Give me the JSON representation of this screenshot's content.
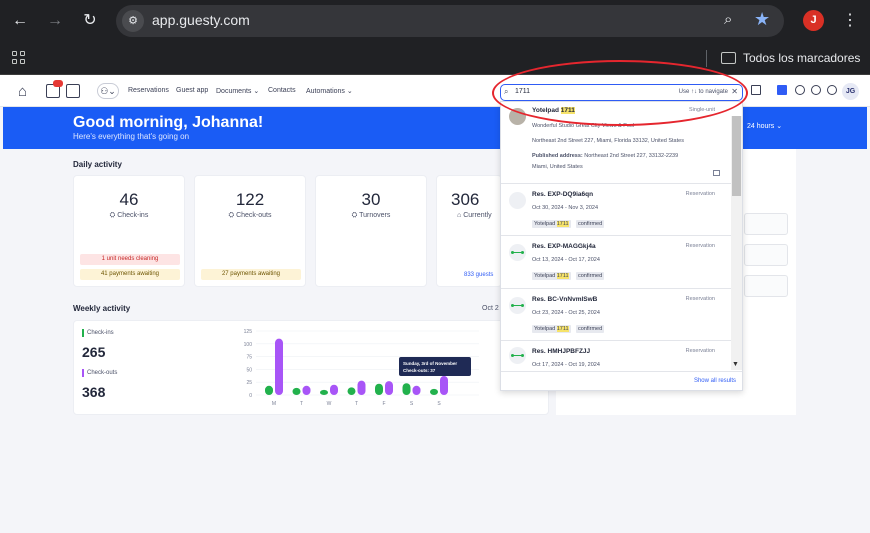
{
  "browser": {
    "url": "app.guesty.com",
    "profile_initial": "J",
    "bookmarks_label": "Todos los marcadores"
  },
  "nav": {
    "notification_count": "",
    "links": [
      "Reservations",
      "Guest app",
      "Documents ⌄",
      "Contacts",
      "Automations ⌄"
    ],
    "user_initials": "JG"
  },
  "hero": {
    "greeting": "Good morning, Johanna!",
    "subtitle": "Here's everything that's going on",
    "hours": "24 hours"
  },
  "daily": {
    "title": "Daily activity",
    "cards": [
      {
        "value": "46",
        "label": "Check-ins",
        "alert_red": "1 unit needs cleaning",
        "alert_yellow": "41 payments awaiting"
      },
      {
        "value": "122",
        "label": "Check-outs",
        "alert_red": "",
        "alert_yellow": "27 payments awaiting"
      },
      {
        "value": "30",
        "label": "Turnovers",
        "alert_red": "",
        "alert_yellow": ""
      },
      {
        "value": "306",
        "label": "Currently",
        "alert_red": "",
        "alert_yellow": "",
        "link": "833 guests"
      }
    ]
  },
  "weekly": {
    "title": "Weekly activity",
    "date": "Oct 2",
    "checkins_label": "Check-ins",
    "checkins_value": "265",
    "checkouts_label": "Check-outs",
    "checkouts_value": "368",
    "tooltip_line1": "Sunday, 3rd of November",
    "tooltip_line2": "Check-outs: 37"
  },
  "chart_data": {
    "type": "bar",
    "categories": [
      "M",
      "T",
      "W",
      "T",
      "F",
      "S",
      "S"
    ],
    "yticks": [
      "125",
      "100",
      "75",
      "50",
      "25",
      "0"
    ],
    "ylim": [
      0,
      125
    ],
    "series": [
      {
        "name": "Check-ins",
        "color": "#22b14c",
        "values": [
          18,
          14,
          10,
          15,
          22,
          23,
          12
        ]
      },
      {
        "name": "Check-outs",
        "color": "#a855f7",
        "values": [
          110,
          18,
          20,
          28,
          27,
          18,
          37
        ]
      }
    ]
  },
  "search": {
    "query": "1711",
    "hint": "Use ↑↓ to navigate",
    "show_all": "Show all results",
    "first": {
      "title_prefix": "Yotelpad ",
      "title_hl": "1711",
      "type": "Single-unit",
      "line1": "Wonderful Studio Great City Views & Pool",
      "line2": "Northeast 2nd Street 227, Miami, Florida 33132, United States",
      "pub_label": "Published address:",
      "pub_value": " Northeast 2nd Street 227, 33132-2239",
      "line4": "Miami, United States"
    },
    "results": [
      {
        "code": "Res. EXP-DQ9ia6qn",
        "type": "Reservation",
        "dates": "Oct 30, 2024 - Nov 3, 2024",
        "unit": "Yotelpad",
        "unit_hl": "1711",
        "status": "confirmed"
      },
      {
        "code": "Res. EXP-MAGGkj4a",
        "type": "Reservation",
        "dates": "Oct 13, 2024 - Oct 17, 2024",
        "unit": "Yotelpad",
        "unit_hl": "1711",
        "status": "confirmed"
      },
      {
        "code": "Res. BC-VnNvmlSwB",
        "type": "Reservation",
        "dates": "Oct 23, 2024 - Oct 25, 2024",
        "unit": "Yotelpad",
        "unit_hl": "1711",
        "status": "confirmed"
      },
      {
        "code": "Res. HMHJPBFZJJ",
        "type": "Reservation",
        "dates": "Oct 17, 2024 - Oct 19, 2024",
        "unit": "",
        "unit_hl": "",
        "status": ""
      }
    ]
  }
}
